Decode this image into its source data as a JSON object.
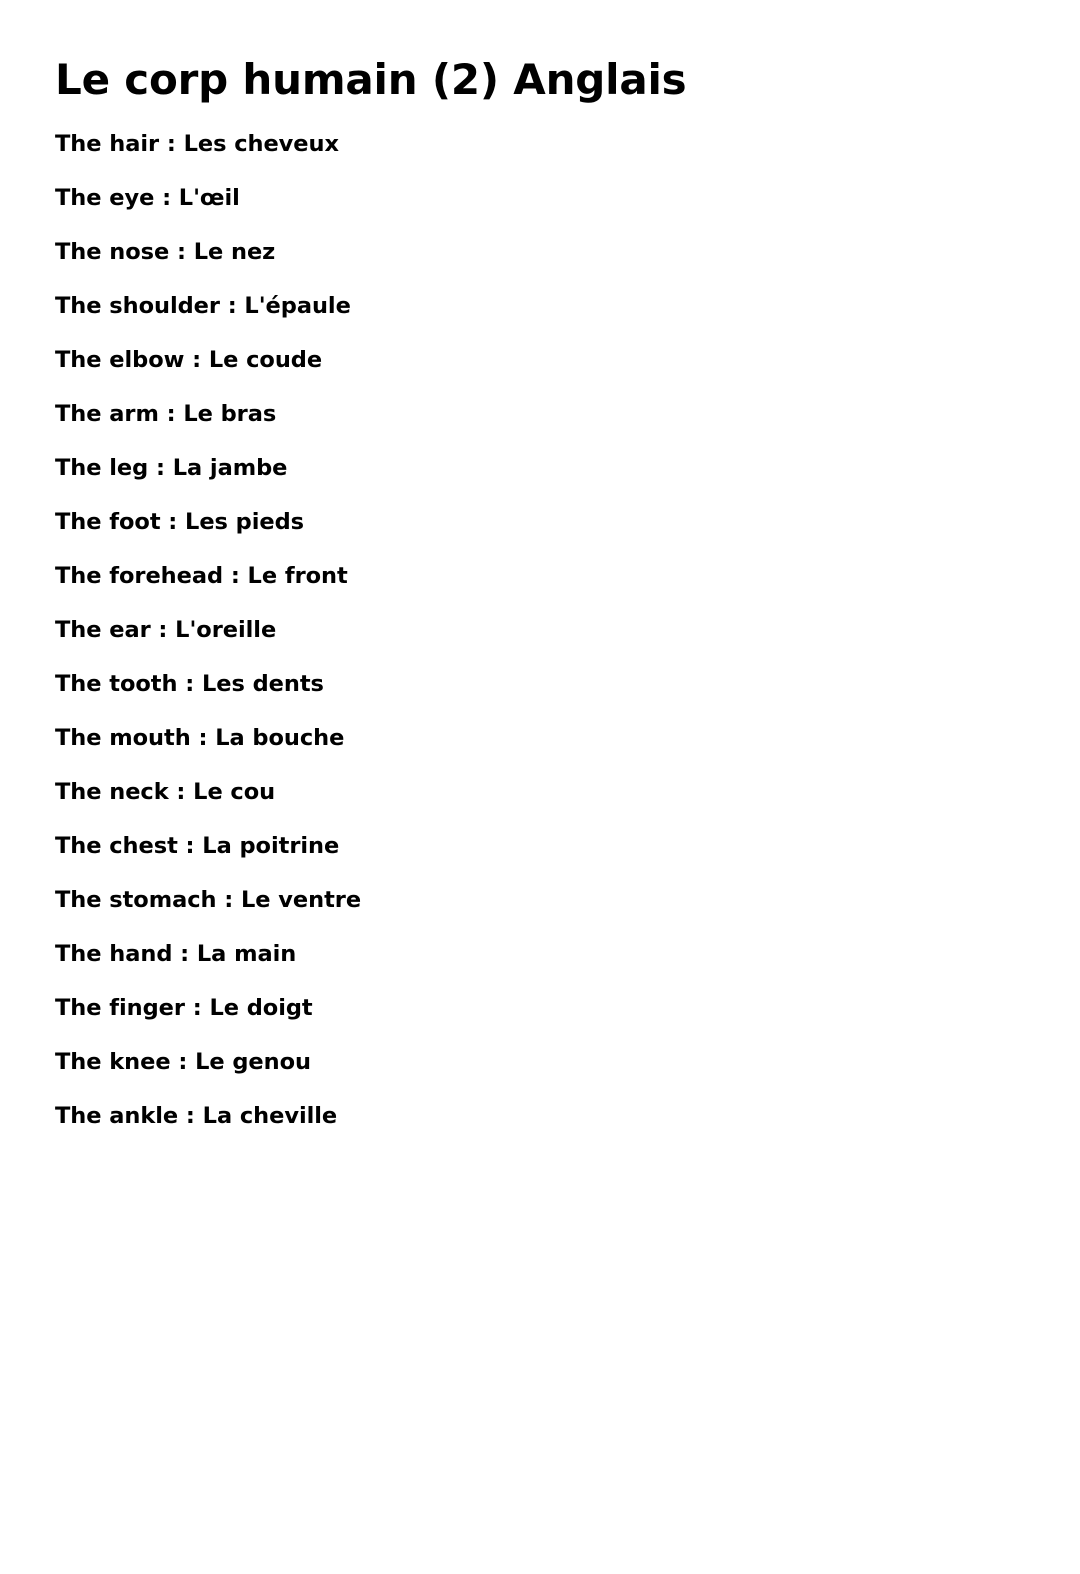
{
  "document": {
    "title": "Le corp humain (2) Anglais",
    "background_color": "#ffffff",
    "text_color": "#000000",
    "entries": [
      {
        "line": "The hair : Les cheveux"
      },
      {
        "line": "The eye : L'œil"
      },
      {
        "line": "The nose : Le nez"
      },
      {
        "line": "The shoulder : L'épaule"
      },
      {
        "line": "The elbow : Le coude"
      },
      {
        "line": "The arm : Le bras"
      },
      {
        "line": "The leg : La jambe"
      },
      {
        "line": "The foot : Les pieds"
      },
      {
        "line": "The forehead : Le front"
      },
      {
        "line": "The ear : L'oreille"
      },
      {
        "line": "The tooth : Les dents"
      },
      {
        "line": "The mouth : La bouche"
      },
      {
        "line": "The neck : Le cou"
      },
      {
        "line": "The chest : La poitrine"
      },
      {
        "line": "The stomach : Le ventre"
      },
      {
        "line": "The hand : La main"
      },
      {
        "line": "The finger : Le doigt"
      },
      {
        "line": "The knee : Le genou"
      },
      {
        "line": "The ankle : La cheville"
      }
    ]
  }
}
